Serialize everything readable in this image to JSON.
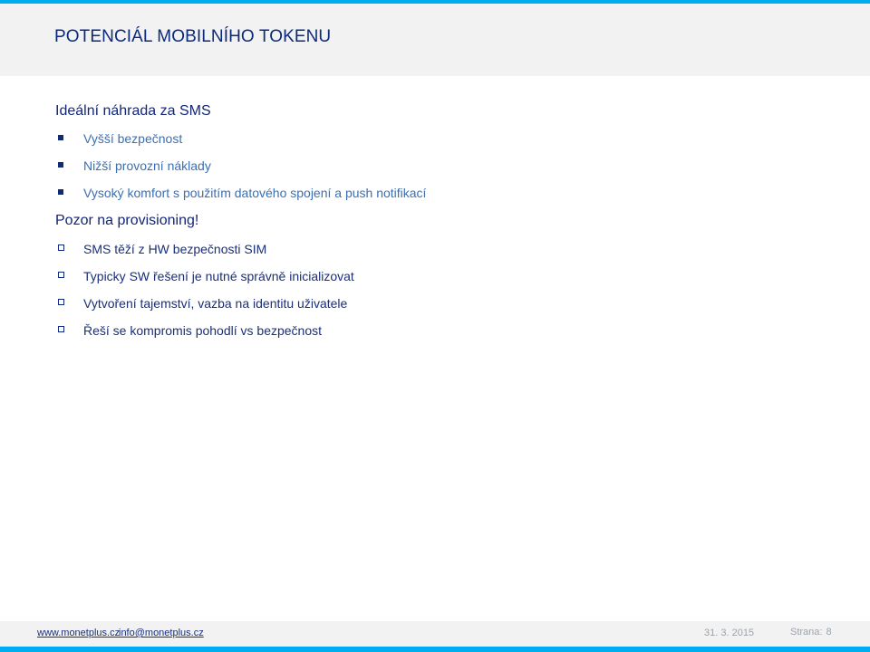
{
  "header": {
    "title": "POTENCIÁL MOBILNÍHO TOKENU"
  },
  "sections": [
    {
      "heading": "Ideální náhrada za SMS",
      "bullets": [
        "Vyšší bezpečnost",
        "Nižší provozní náklady",
        "Vysoký komfort s použitím datového spojení a push notifikací"
      ]
    },
    {
      "heading": "Pozor na provisioning!",
      "bullets": [
        "SMS těží z HW bezpečnosti SIM",
        "Typicky SW řešení je nutné správně inicializovat",
        "Vytvoření tajemství, vazba na identitu uživatele",
        "Řeší se kompromis pohodlí vs bezpečnost"
      ]
    }
  ],
  "footer": {
    "website": "www.monetplus.cz",
    "email": "info@monetplus.cz",
    "date": "31. 3. 2015",
    "page_label": "Strana:",
    "page_number": "8"
  },
  "colors": {
    "accent": "#00aeef",
    "title": "#0b2a7a",
    "band": "#f2f2f2"
  }
}
